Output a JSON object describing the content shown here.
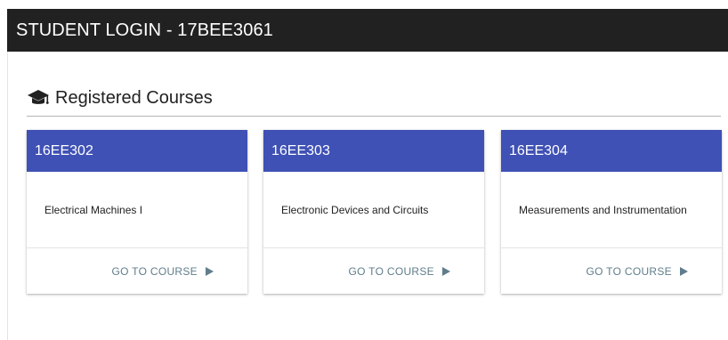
{
  "header": {
    "title": "STUDENT LOGIN - 17BEE3061",
    "background": "#212121"
  },
  "section": {
    "icon": "graduation-cap-icon",
    "title": "Registered Courses"
  },
  "courses": [
    {
      "code": "16EE302",
      "name": "Electrical Machines I",
      "action_label": "GO TO COURSE"
    },
    {
      "code": "16EE303",
      "name": "Electronic Devices and Circuits",
      "action_label": "GO TO COURSE"
    },
    {
      "code": "16EE304",
      "name": "Measurements and Instrumentation",
      "action_label": "GO TO COURSE"
    }
  ],
  "colors": {
    "card_header": "#3f51b5",
    "action_text": "#607d8b"
  }
}
